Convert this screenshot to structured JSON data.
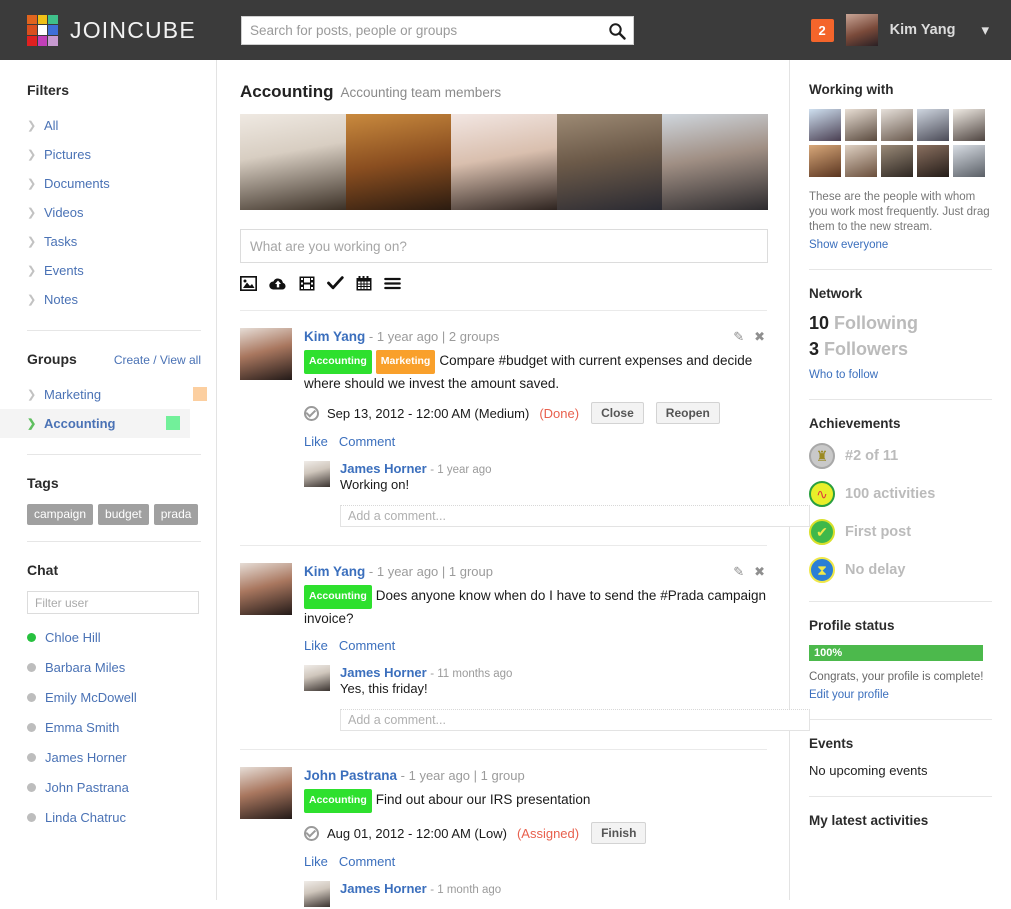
{
  "header": {
    "brand": "JOINCUBE",
    "logo_colors": [
      "#e0641e",
      "#f0c017",
      "#3fc08a",
      "#d94f1e",
      "#ffffff",
      "#3f6fd8",
      "#e02020",
      "#c13fb8",
      "#c79ad0"
    ],
    "search": {
      "placeholder": "Search for posts, people or groups",
      "value": "",
      "icon": "search-icon"
    },
    "notification_count": "2",
    "user_name": "Kim Yang",
    "caret_icon": "chevron-down-icon"
  },
  "sidebar": {
    "filters_title": "Filters",
    "filters": [
      {
        "label": "All"
      },
      {
        "label": "Pictures"
      },
      {
        "label": "Documents"
      },
      {
        "label": "Videos"
      },
      {
        "label": "Tasks"
      },
      {
        "label": "Events"
      },
      {
        "label": "Notes"
      }
    ],
    "groups_title": "Groups",
    "groups_link": "Create / View all",
    "groups": [
      {
        "label": "Marketing",
        "color": "#fccfa0",
        "active": false
      },
      {
        "label": "Accounting",
        "color": "#72f09a",
        "active": true
      }
    ],
    "tags_title": "Tags",
    "tags": [
      "campaign",
      "budget",
      "prada"
    ],
    "chat_title": "Chat",
    "chat_filter_placeholder": "Filter user",
    "chat_filter_value": "",
    "chat_users": [
      {
        "name": "Chloe Hill",
        "online": true
      },
      {
        "name": "Barbara Miles",
        "online": false
      },
      {
        "name": "Emily McDowell",
        "online": false
      },
      {
        "name": "Emma Smith",
        "online": false
      },
      {
        "name": "James Horner",
        "online": false
      },
      {
        "name": "John Pastrana",
        "online": false
      },
      {
        "name": "Linda Chatruc",
        "online": false
      }
    ]
  },
  "main": {
    "title": "Accounting",
    "subtitle": "Accounting team members",
    "member_photos": [
      "#ded6cd",
      "#b8763a",
      "#ecddd6",
      "#8a7462",
      "#9fa9b4"
    ],
    "composer_placeholder": "What are you working on?",
    "composer_value": "",
    "composer_tools": [
      "image-icon",
      "cloud-upload-icon",
      "film-icon",
      "check-icon",
      "calendar-icon",
      "list-icon"
    ],
    "comment_placeholder": "Add a comment...",
    "like_label": "Like",
    "comment_label": "Comment",
    "posts": [
      {
        "author": "Kim Yang",
        "meta": "- 1 year ago | 2 groups",
        "avatar_color": "#9c6f5e",
        "chips": [
          {
            "label": "Accounting",
            "kind": "accounting"
          },
          {
            "label": "Marketing",
            "kind": "marketing"
          }
        ],
        "text": "Compare #budget with current expenses and decide where should we invest the amount saved.",
        "task": {
          "date": "Sep 13, 2012 - 12:00 AM (Medium)",
          "state": "(Done)",
          "buttons": [
            "Close",
            "Reopen"
          ]
        },
        "comments": [
          {
            "author": "James Horner",
            "meta": "- 1 year ago",
            "text": "Working on!",
            "avatar_color": "#cfcac4"
          }
        ]
      },
      {
        "author": "Kim Yang",
        "meta": "- 1 year ago | 1 group",
        "avatar_color": "#9c6f5e",
        "chips": [
          {
            "label": "Accounting",
            "kind": "accounting"
          }
        ],
        "text": "Does anyone know when do I have to send the #Prada campaign invoice?",
        "task": null,
        "comments": [
          {
            "author": "James Horner",
            "meta": "- 11 months ago",
            "text": "Yes, this friday!",
            "avatar_color": "#cfcac4"
          }
        ]
      },
      {
        "author": "John Pastrana",
        "meta": "- 1 year ago | 1 group",
        "avatar_color": "#a8713f",
        "chips": [
          {
            "label": "Accounting",
            "kind": "accounting"
          }
        ],
        "text": "Find out abour our IRS presentation",
        "task": {
          "date": "Aug 01, 2012 - 12:00 AM (Low)",
          "state": "(Assigned)",
          "buttons": [
            "Finish"
          ]
        },
        "comments": [
          {
            "author": "James Horner",
            "meta": "- 1 month ago",
            "text": "",
            "avatar_color": "#cfcac4"
          }
        ]
      }
    ]
  },
  "right": {
    "working_with_title": "Working with",
    "working_with_avatars": [
      "#b9c9dd",
      "#d8cfc6",
      "#d4cec6",
      "#b2bac6",
      "#e0dcd6",
      "#b07d52",
      "#cdb9a8",
      "#8e7f71",
      "#6d5c51",
      "#b9bfc6"
    ],
    "working_with_note": "These are the people with whom you work most frequently. Just drag them to the new stream.",
    "show_everyone": "Show everyone",
    "network_title": "Network",
    "following_count": "10",
    "following_label": "Following",
    "followers_count": "3",
    "followers_label": "Followers",
    "who_to_follow": "Who to follow",
    "achievements_title": "Achievements",
    "achievements": [
      {
        "label": "#2 of 11",
        "icon": "trophy-icon",
        "bg": "#c9c9c9",
        "ring": "#a8a8a8",
        "fg": "#9b8a22"
      },
      {
        "label": "100 activities",
        "icon": "activity-icon",
        "bg": "#e9ef2a",
        "ring": "#2a9f3f",
        "fg": "#e0403a"
      },
      {
        "label": "First post",
        "icon": "check-badge-icon",
        "bg": "#3fb84a",
        "ring": "#d9e02a",
        "fg": "#f0e84a"
      },
      {
        "label": "No delay",
        "icon": "hourglass-icon",
        "bg": "#2b7fd6",
        "ring": "#f0e84a",
        "fg": "#f0e84a"
      }
    ],
    "profile_status_title": "Profile status",
    "profile_percent": "100%",
    "profile_percent_value": 100,
    "profile_note": "Congrats, your profile is complete!",
    "edit_profile": "Edit your profile",
    "events_title": "Events",
    "events_empty": "No upcoming events",
    "activities_title": "My latest activities"
  }
}
